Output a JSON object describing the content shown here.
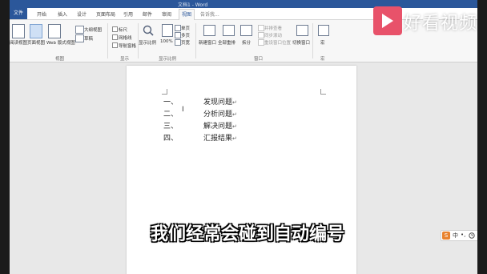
{
  "window": {
    "title": "文档1 - Word"
  },
  "tabs": {
    "file": "文件",
    "items": [
      "开始",
      "插入",
      "设计",
      "页面布局",
      "引用",
      "邮件",
      "审阅",
      "视图"
    ],
    "active": "视图",
    "tell_me": "告诉我..."
  },
  "ribbon": {
    "views": {
      "read_mode": "阅读视图",
      "print_layout": "页面视图",
      "web_layout": "Web 版式视图",
      "outline": "大纲视图",
      "draft": "草稿",
      "group_label": "视图"
    },
    "show": {
      "ruler": "标尺",
      "gridlines": "网格线",
      "nav_pane": "导航窗格",
      "group_label": "显示"
    },
    "zoom": {
      "zoom": "显示比例",
      "hundred": "100%",
      "one_page": "单页",
      "multi_page": "多页",
      "page_width": "页宽",
      "group_label": "显示比例"
    },
    "window": {
      "new_window": "新建窗口",
      "arrange_all": "全部重排",
      "split": "拆分",
      "side_by_side": "并排查看",
      "sync_scroll": "同步滚动",
      "reset_pos": "重设窗口位置",
      "switch": "切换窗口",
      "group_label": "窗口"
    },
    "macros": {
      "macros": "宏",
      "group_label": "宏"
    }
  },
  "document": {
    "items": [
      {
        "num": "一、",
        "text": "发现问题"
      },
      {
        "num": "二、",
        "text": "分析问题"
      },
      {
        "num": "三、",
        "text": "解决问题"
      },
      {
        "num": "四、",
        "text": "汇报结果"
      }
    ],
    "para_mark": "↵"
  },
  "watermark": {
    "brand": "好看视频"
  },
  "subtitle": "我们经常会碰到自动编号",
  "ime": {
    "logo": "S",
    "lang": "中",
    "punct": "•,"
  },
  "colors": {
    "accent": "#2b579a",
    "brand": "#e8526a"
  }
}
